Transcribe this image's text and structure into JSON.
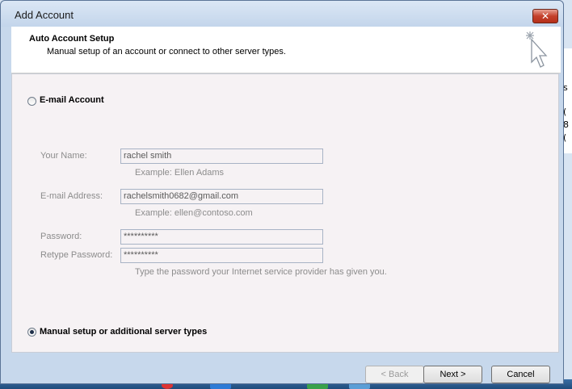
{
  "window": {
    "title": "Add Account",
    "close_glyph": "✕"
  },
  "header": {
    "title": "Auto Account Setup",
    "subtitle": "Manual setup of an account or connect to other server types."
  },
  "options": {
    "email_account": {
      "label": "E-mail Account",
      "selected": false
    },
    "manual_setup": {
      "label": "Manual setup or additional server types",
      "selected": true
    }
  },
  "form": {
    "name": {
      "label": "Your Name:",
      "value": "rachel smith",
      "hint": "Example: Ellen Adams"
    },
    "email": {
      "label": "E-mail Address:",
      "value": "rachelsmith0682@gmail.com",
      "hint": "Example: ellen@contoso.com"
    },
    "password": {
      "label": "Password:",
      "value": "**********"
    },
    "retype_password": {
      "label": "Retype Password:",
      "value": "**********"
    },
    "password_hint": "Type the password your Internet service provider has given you."
  },
  "buttons": {
    "back": "< Back",
    "next": "Next >",
    "cancel": "Cancel"
  },
  "background": {
    "chars": [
      "s",
      "(",
      "8",
      "("
    ]
  },
  "colors": {
    "accent": "#1f4b7a",
    "close": "#c4402b"
  }
}
